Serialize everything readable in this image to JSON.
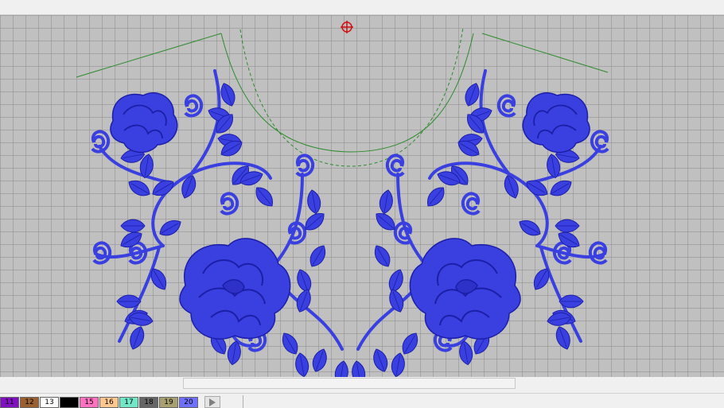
{
  "canvas": {
    "background": "#c0c0c0",
    "grid_color": "#8a8a8a",
    "thread_color": "#3a3fe0",
    "thread_dark": "#1c1fa8",
    "outline_color": "#2e8b2e",
    "cursor_color": "#d01010"
  },
  "palette": {
    "swatches": [
      {
        "label": "11",
        "color": "#8010c0"
      },
      {
        "label": "12",
        "color": "#9a6030"
      },
      {
        "label": "13",
        "color": "#ffffff"
      },
      {
        "label": "",
        "color": "#000000"
      },
      {
        "label": "15",
        "color": "#ff70c0"
      },
      {
        "label": "16",
        "color": "#ffc890"
      },
      {
        "label": "17",
        "color": "#70e8c8"
      },
      {
        "label": "18",
        "color": "#666666"
      },
      {
        "label": "19",
        "color": "#a8a070"
      },
      {
        "label": "20",
        "color": "#7070ff"
      }
    ]
  }
}
